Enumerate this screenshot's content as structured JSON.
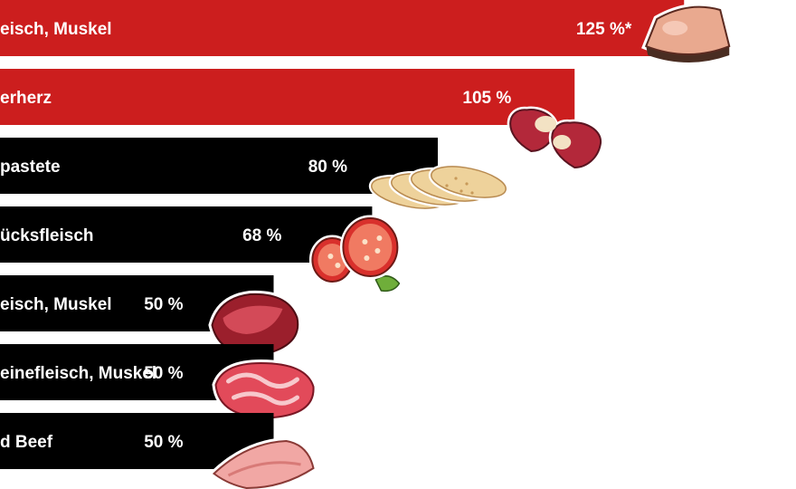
{
  "chart_data": {
    "type": "bar",
    "orientation": "horizontal",
    "categories": [
      "eisch, Muskel",
      "erherz",
      "pastete",
      "ücksfleisch",
      "eisch, Muskel",
      "einefleisch, Muskel",
      "d Beef"
    ],
    "values": [
      125,
      105,
      80,
      68,
      50,
      50,
      50
    ],
    "value_labels": [
      "125 %*",
      "105 %",
      "80 %",
      "68 %",
      "50 %",
      "50 %",
      "50 %"
    ],
    "highlighted": [
      true,
      true,
      false,
      false,
      false,
      false,
      false
    ],
    "icons": [
      "ham-slice-icon",
      "chicken-hearts-icon",
      "liver-pate-slices-icon",
      "salami-slices-icon",
      "beef-chunk-icon",
      "pork-steak-icon",
      "corned-beef-slice-icon"
    ],
    "colors": {
      "highlight": "#cc1e1e",
      "normal": "#000000",
      "text": "#ffffff"
    },
    "xlim": [
      0,
      100
    ],
    "title": "",
    "xlabel": "",
    "ylabel": "",
    "grid": false,
    "legend": "none"
  }
}
